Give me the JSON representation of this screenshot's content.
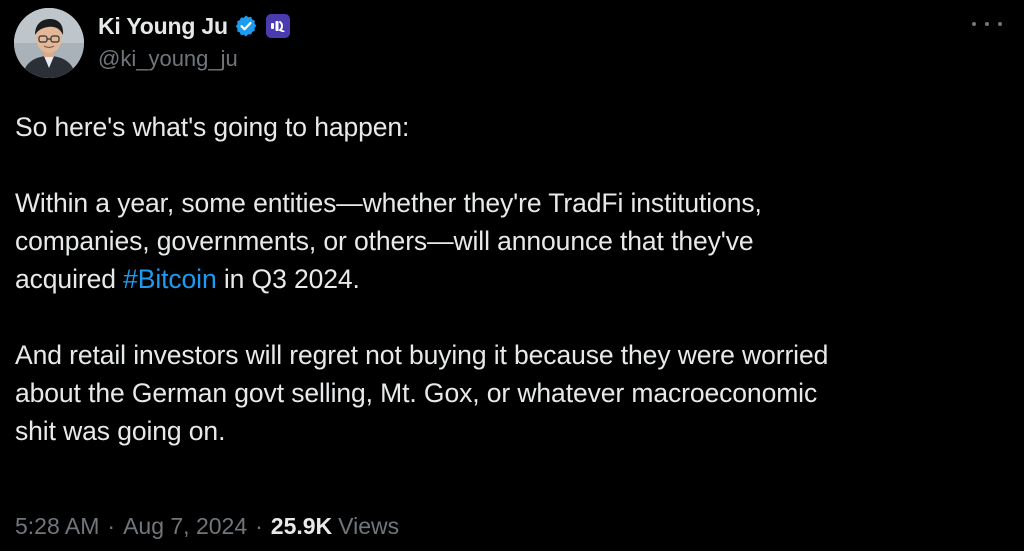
{
  "author": {
    "display_name": "Ki Young Ju",
    "handle": "@ki_young_ju",
    "verified": true,
    "affiliate_badge_icon": "cryptoquant-logo-icon",
    "avatar_icon": "profile-avatar"
  },
  "tweet": {
    "line1": "So here's what's going to happen:",
    "para2_part1": "Within a year, some entities—whether they're TradFi institutions,",
    "para2_part2": "companies, governments, or others—will announce that they've",
    "para2_part3_prefix": "acquired ",
    "hashtag": "#Bitcoin",
    "para2_part3_suffix": " in Q3 2024.",
    "para3_line1": "And retail investors will regret not buying it because they were worried",
    "para3_line2": "about the German govt selling, Mt. Gox, or whatever macroeconomic",
    "para3_line3": "shit was going on."
  },
  "meta": {
    "time": "5:28 AM",
    "separator": "·",
    "date": "Aug 7, 2024",
    "views_count": "25.9K",
    "views_label": "Views"
  },
  "colors": {
    "background": "#000000",
    "text": "#e7e9ea",
    "secondary": "#71767b",
    "link": "#1d9bf0",
    "verified": "#1d9bf0",
    "affiliate": "#4b3bb0"
  }
}
